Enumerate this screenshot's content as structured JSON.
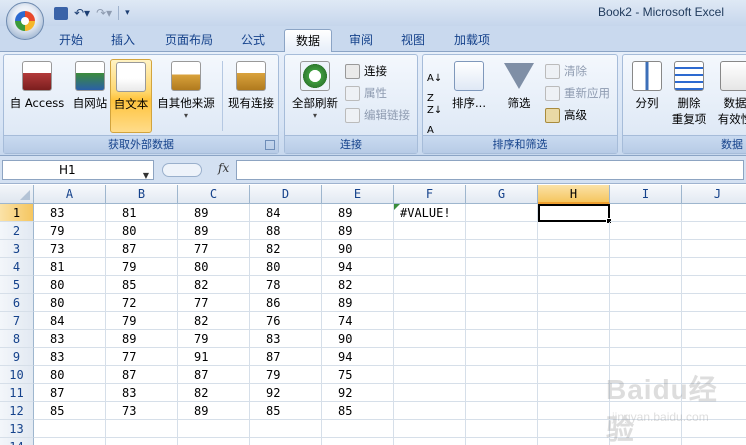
{
  "window": {
    "title": "Book2 - Microsoft Excel"
  },
  "tabs": [
    {
      "label": "开始",
      "active": false
    },
    {
      "label": "插入",
      "active": false
    },
    {
      "label": "页面布局",
      "active": false
    },
    {
      "label": "公式",
      "active": false
    },
    {
      "label": "数据",
      "active": true
    },
    {
      "label": "审阅",
      "active": false
    },
    {
      "label": "视图",
      "active": false
    },
    {
      "label": "加载项",
      "active": false
    }
  ],
  "ribbon": {
    "external_data": {
      "label": "获取外部数据",
      "buttons": [
        {
          "label": "自 Access",
          "icon": "access-icon"
        },
        {
          "label": "自网站",
          "icon": "web-icon"
        },
        {
          "label": "自文本",
          "icon": "text-file-icon",
          "active": true
        },
        {
          "label": "自其他来源",
          "icon": "other-sources-icon"
        },
        {
          "label": "现有连接",
          "icon": "existing-connections-icon"
        }
      ]
    },
    "connections": {
      "label": "连接",
      "refresh_all": "全部刷新",
      "connect": "连接",
      "properties": "属性",
      "edit_links": "编辑链接"
    },
    "sort_filter": {
      "label": "排序和筛选",
      "sort": "排序...",
      "filter": "筛选",
      "clear": "清除",
      "reapply": "重新应用",
      "advanced": "高级"
    },
    "data_tools": {
      "label": "数据",
      "text_to_columns": "分列",
      "remove_duplicates_1": "删除",
      "remove_duplicates_2": "重复项",
      "validation_1": "数据",
      "validation_2": "有效性"
    }
  },
  "formula_bar": {
    "name_box": "H1",
    "fx": "fx",
    "formula": ""
  },
  "sheet": {
    "columns": [
      "A",
      "B",
      "C",
      "D",
      "E",
      "F",
      "G",
      "H",
      "I",
      "J"
    ],
    "selected_column": "H",
    "selected_row": 1,
    "rows": [
      {
        "num": "1",
        "cells": [
          "83",
          "81",
          "89",
          "84",
          "89",
          "#VALUE!",
          "",
          "",
          "",
          ""
        ]
      },
      {
        "num": "2",
        "cells": [
          "79",
          "80",
          "89",
          "88",
          "89",
          "",
          "",
          "",
          "",
          ""
        ]
      },
      {
        "num": "3",
        "cells": [
          "73",
          "87",
          "77",
          "82",
          "90",
          "",
          "",
          "",
          "",
          ""
        ]
      },
      {
        "num": "4",
        "cells": [
          "81",
          "79",
          "80",
          "80",
          "94",
          "",
          "",
          "",
          "",
          ""
        ]
      },
      {
        "num": "5",
        "cells": [
          "80",
          "85",
          "82",
          "78",
          "82",
          "",
          "",
          "",
          "",
          ""
        ]
      },
      {
        "num": "6",
        "cells": [
          "80",
          "72",
          "77",
          "86",
          "89",
          "",
          "",
          "",
          "",
          ""
        ]
      },
      {
        "num": "7",
        "cells": [
          "84",
          "79",
          "82",
          "76",
          "74",
          "",
          "",
          "",
          "",
          ""
        ]
      },
      {
        "num": "8",
        "cells": [
          "83",
          "89",
          "79",
          "83",
          "90",
          "",
          "",
          "",
          "",
          ""
        ]
      },
      {
        "num": "9",
        "cells": [
          "83",
          "77",
          "91",
          "87",
          "94",
          "",
          "",
          "",
          "",
          ""
        ]
      },
      {
        "num": "10",
        "cells": [
          "80",
          "87",
          "87",
          "79",
          "75",
          "",
          "",
          "",
          "",
          ""
        ]
      },
      {
        "num": "11",
        "cells": [
          "87",
          "83",
          "82",
          "92",
          "92",
          "",
          "",
          "",
          "",
          ""
        ]
      },
      {
        "num": "12",
        "cells": [
          "85",
          "73",
          "89",
          "85",
          "85",
          "",
          "",
          "",
          "",
          ""
        ]
      },
      {
        "num": "13",
        "cells": [
          "",
          "",
          "",
          "",
          "",
          "",
          "",
          "",
          "",
          ""
        ]
      },
      {
        "num": "14",
        "cells": [
          "",
          "",
          "",
          "",
          "",
          "",
          "",
          "",
          "",
          ""
        ]
      }
    ]
  },
  "watermark": {
    "brand": "Baidu经验",
    "url": "jingyan.baidu.com"
  },
  "colors": {
    "accent": "#15428b",
    "selection": "#f5c660",
    "error_indicator": "#3a8c3a"
  }
}
